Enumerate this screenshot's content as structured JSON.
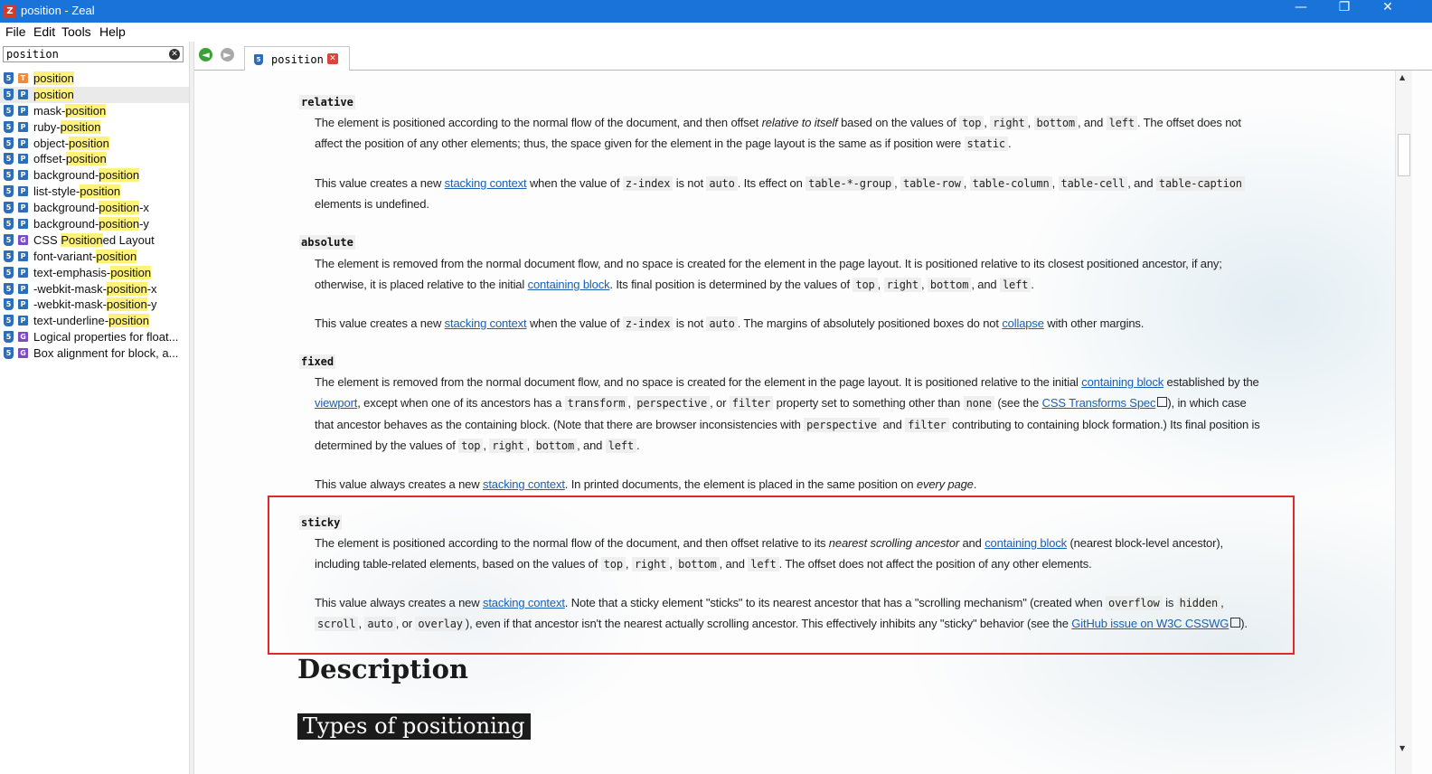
{
  "window": {
    "title": "position - Zeal",
    "icon_letter": "Z",
    "minimize": "—",
    "maximize": "❐",
    "close": "✕"
  },
  "menu": [
    "File",
    "Edit",
    "Tools",
    "Help"
  ],
  "search": {
    "value": "position"
  },
  "results": [
    {
      "type": "T",
      "color": "#f08a3a",
      "pre": "",
      "hl": "position",
      "post": ""
    },
    {
      "type": "P",
      "color": "#2f6eb5",
      "pre": "",
      "hl": "position",
      "post": ""
    },
    {
      "type": "P",
      "color": "#2f6eb5",
      "pre": "mask-",
      "hl": "position",
      "post": ""
    },
    {
      "type": "P",
      "color": "#2f6eb5",
      "pre": "ruby-",
      "hl": "position",
      "post": ""
    },
    {
      "type": "P",
      "color": "#2f6eb5",
      "pre": "object-",
      "hl": "position",
      "post": ""
    },
    {
      "type": "P",
      "color": "#2f6eb5",
      "pre": "offset-",
      "hl": "position",
      "post": ""
    },
    {
      "type": "P",
      "color": "#2f6eb5",
      "pre": "background-",
      "hl": "position",
      "post": ""
    },
    {
      "type": "P",
      "color": "#2f6eb5",
      "pre": "list-style-",
      "hl": "position",
      "post": ""
    },
    {
      "type": "P",
      "color": "#2f6eb5",
      "pre": "background-",
      "hl": "position",
      "post": "-x"
    },
    {
      "type": "P",
      "color": "#2f6eb5",
      "pre": "background-",
      "hl": "position",
      "post": "-y"
    },
    {
      "type": "G",
      "color": "#7b4bc4",
      "pre": "CSS ",
      "hl": "Position",
      "post": "ed Layout"
    },
    {
      "type": "P",
      "color": "#2f6eb5",
      "pre": "font-variant-",
      "hl": "position",
      "post": ""
    },
    {
      "type": "P",
      "color": "#2f6eb5",
      "pre": "text-emphasis-",
      "hl": "position",
      "post": ""
    },
    {
      "type": "P",
      "color": "#2f6eb5",
      "pre": "-webkit-mask-",
      "hl": "position",
      "post": "-x"
    },
    {
      "type": "P",
      "color": "#2f6eb5",
      "pre": "-webkit-mask-",
      "hl": "position",
      "post": "-y"
    },
    {
      "type": "P",
      "color": "#2f6eb5",
      "pre": "text-underline-",
      "hl": "position",
      "post": ""
    },
    {
      "type": "G",
      "color": "#7b4bc4",
      "pre": "Logical properties for float...",
      "hl": "",
      "post": ""
    },
    {
      "type": "G",
      "color": "#7b4bc4",
      "pre": "Box alignment for block, a...",
      "hl": "",
      "post": ""
    }
  ],
  "nav": {
    "back": "◄",
    "forward": "►"
  },
  "tab": {
    "label": "position",
    "close": "✕"
  },
  "doc": {
    "terms": {
      "relative": "relative",
      "absolute": "absolute",
      "fixed": "fixed",
      "sticky": "sticky"
    },
    "description": "Description",
    "types_heading": "Types of positioning"
  }
}
